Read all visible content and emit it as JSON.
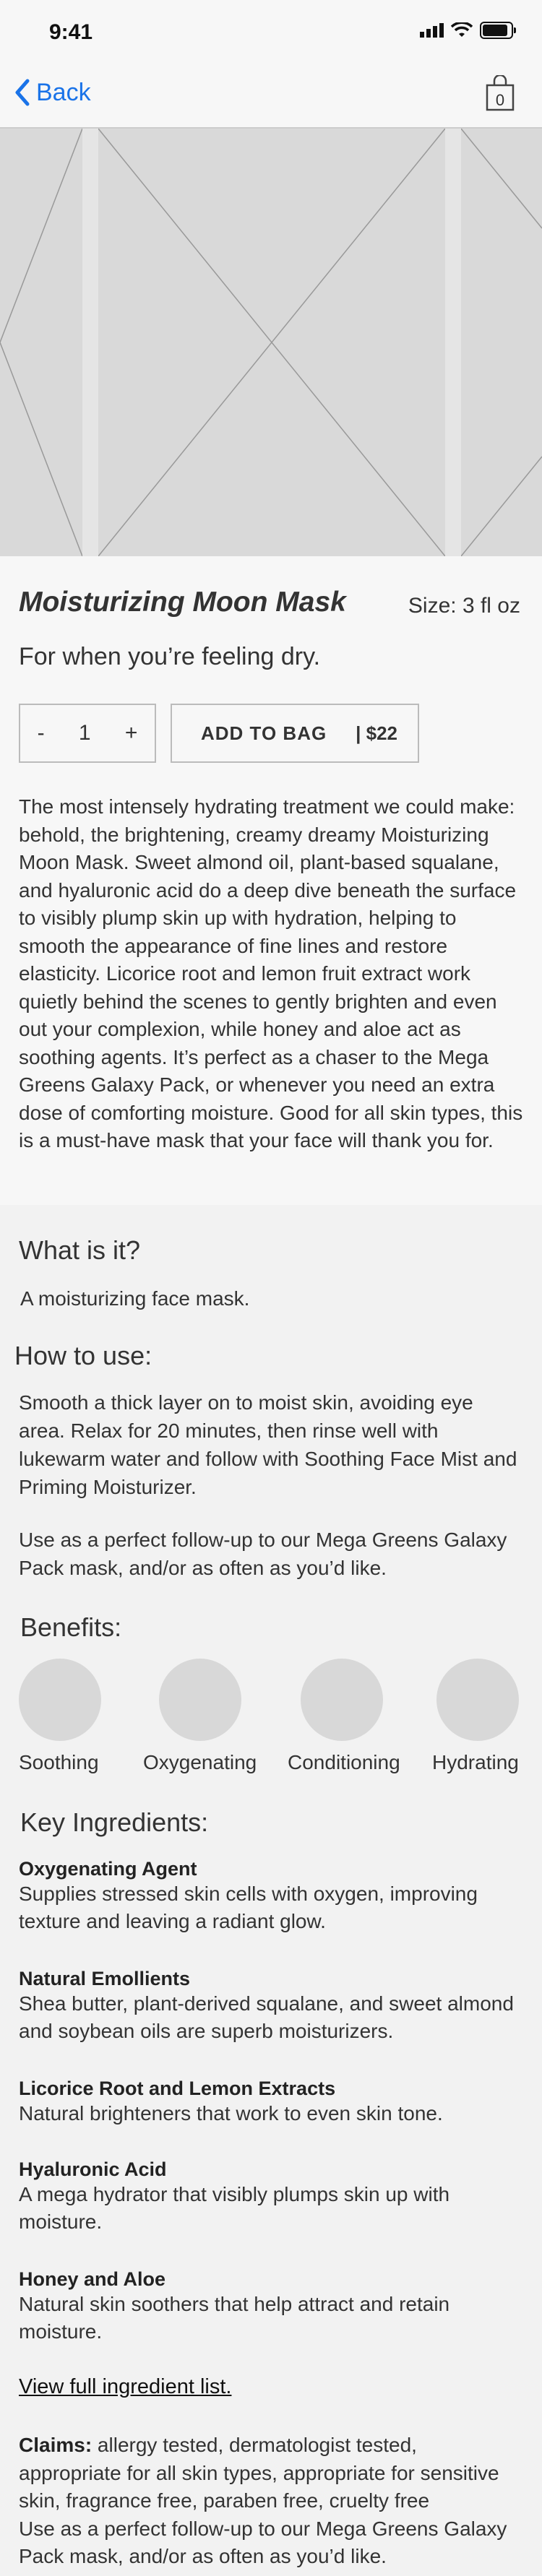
{
  "status_bar": {
    "time": "9:41"
  },
  "nav": {
    "back_label": "Back",
    "bag_count": "0"
  },
  "product": {
    "title": "Moisturizing Moon Mask",
    "size": "Size: 3 fl oz",
    "subtitle": "For when you’re feeling dry.",
    "quantity": "1",
    "qty_minus": "-",
    "qty_plus": "+",
    "add_label": "ADD TO BAG",
    "price": "| $22",
    "description": "The most intensely hydrating treatment we could make: behold, the brightening, creamy dreamy Moisturizing Moon Mask. Sweet almond oil, plant-based squalane, and hyaluronic acid do a deep dive beneath the surface to visibly plump skin up with hydration, helping to smooth the appearance of fine lines and restore elasticity. Licorice root and lemon fruit extract work quietly behind the scenes to gently brighten and even out your complexion, while honey and aloe act as soothing agents. It’s perfect as a chaser to the Mega Greens Galaxy Pack, or whenever you need an extra dose of comforting moisture. Good for all skin types, this is a must-have mask that your face will thank you for."
  },
  "what_is_it": {
    "heading": "What is it?",
    "text": "A moisturizing face mask."
  },
  "how_to_use": {
    "heading": "How to use:",
    "text1": "Smooth a thick layer on to moist skin, avoiding eye area. Relax for 20 minutes, then rinse well with lukewarm water and follow with Soothing Face Mist and Priming Moisturizer.",
    "text2": "Use as a perfect follow-up to our Mega Greens Galaxy Pack mask, and/or as often as you’d like."
  },
  "benefits": {
    "heading": "Benefits:",
    "items": [
      "Soothing",
      "Oxygenating",
      "Conditioning",
      "Hydrating"
    ]
  },
  "ingredients": {
    "heading": "Key Ingredients:",
    "items": [
      {
        "name": "Oxygenating Agent",
        "desc": "Supplies stressed skin cells with oxygen, improving texture and leaving a radiant glow."
      },
      {
        "name": "Natural Emollients",
        "desc": "Shea butter, plant-derived squalane, and sweet almond and soybean oils are superb moisturizers."
      },
      {
        "name": "Licorice Root and Lemon Extracts",
        "desc": "Natural brighteners that work to even skin tone."
      },
      {
        "name": "Hyaluronic Acid",
        "desc": "A mega hydrator that visibly plumps skin up with moisture."
      },
      {
        "name": "Honey and Aloe",
        "desc": "Natural skin soothers that help attract and retain moisture."
      }
    ],
    "link": "View full ingredient list."
  },
  "claims": {
    "label": "Claims:",
    "text": " allergy tested, dermatologist tested, appropriate for all skin types, appropriate for sensitive skin, fragrance free, paraben free, cruelty free",
    "follow_up": "Use as a perfect follow-up to our Mega Greens Galaxy Pack mask, and/or as often as you’d like."
  },
  "colors": {
    "accent": "#1a73e8",
    "placeholder": "#d9d9d9",
    "background": "#f7f7f7"
  }
}
